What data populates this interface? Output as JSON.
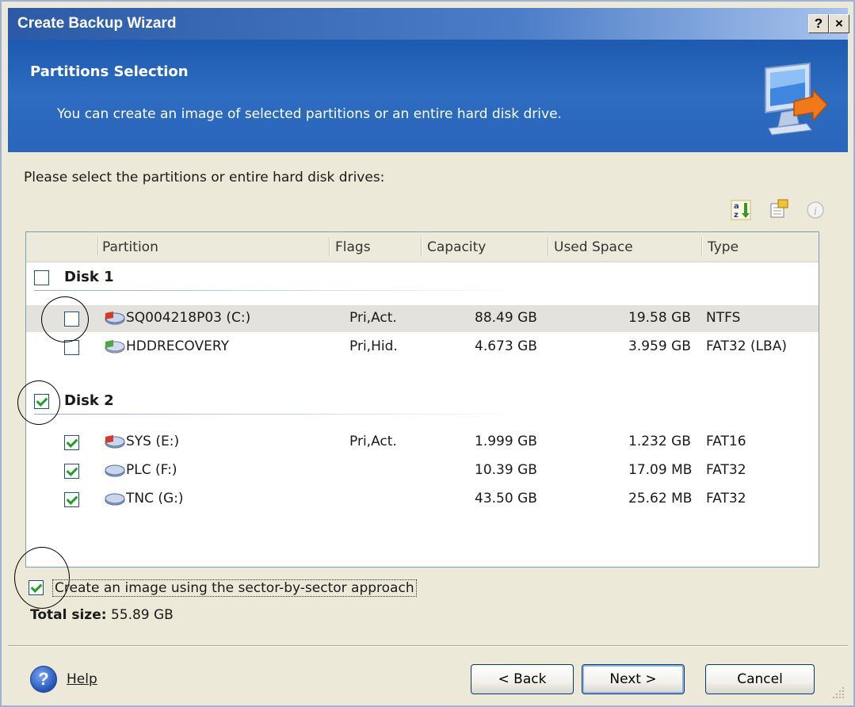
{
  "window": {
    "title": "Create Backup Wizard",
    "help_glyph": "?",
    "close_glyph": "×"
  },
  "header": {
    "title": "Partitions Selection",
    "subtitle": "You can create an image of selected partitions or an entire hard disk drive.",
    "icon": "monitor-with-arrow-icon"
  },
  "prompt": "Please select the partitions or entire hard disk drives:",
  "toolbar": {
    "icons": [
      "sort-az-icon",
      "properties-icon",
      "info-icon"
    ]
  },
  "columns": [
    "Partition",
    "Flags",
    "Capacity",
    "Used Space",
    "Type"
  ],
  "disks": [
    {
      "name": "Disk 1",
      "checked": false,
      "partitions": [
        {
          "name": "SQ004218P03 (C:)",
          "flags": "Pri,Act.",
          "capacity": "88.49 GB",
          "used": "19.58 GB",
          "type": "NTFS",
          "checked": false,
          "selected": true
        },
        {
          "name": "HDDRECOVERY",
          "flags": "Pri,Hid.",
          "capacity": "4.673 GB",
          "used": "3.959 GB",
          "type": "FAT32 (LBA)",
          "checked": false,
          "selected": false
        }
      ]
    },
    {
      "name": "Disk 2",
      "checked": true,
      "partitions": [
        {
          "name": "SYS (E:)",
          "flags": "Pri,Act.",
          "capacity": "1.999 GB",
          "used": "1.232 GB",
          "type": "FAT16",
          "checked": true,
          "selected": false
        },
        {
          "name": "PLC (F:)",
          "flags": "",
          "capacity": "10.39 GB",
          "used": "17.09 MB",
          "type": "FAT32",
          "checked": true,
          "selected": false
        },
        {
          "name": "TNC (G:)",
          "flags": "",
          "capacity": "43.50 GB",
          "used": "25.62 MB",
          "type": "FAT32",
          "checked": true,
          "selected": false
        }
      ]
    }
  ],
  "sector_option": {
    "label": "Create an image using the sector-by-sector approach",
    "checked": true
  },
  "total": {
    "label": "Total size:",
    "value": "55.89 GB"
  },
  "footer": {
    "help": "Help",
    "back": "< Back",
    "next": "Next >",
    "cancel": "Cancel"
  },
  "colors": {
    "header_blue": "#2a66bb",
    "title_blue": "#2c5aa6",
    "check_green": "#21a121",
    "dialog_bg": "#ece9d8"
  }
}
